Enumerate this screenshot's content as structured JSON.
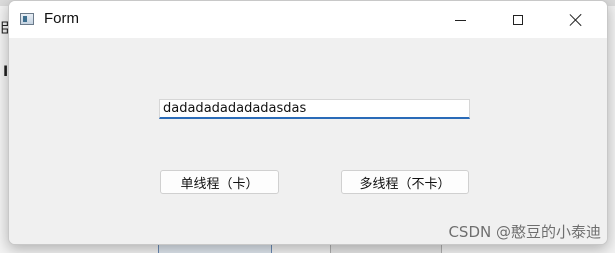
{
  "window": {
    "title": "Form",
    "icon": "app-window-icon",
    "controls": {
      "minimize_icon": "minimize-icon",
      "maximize_icon": "maximize-icon",
      "close_icon": "close-icon"
    }
  },
  "form": {
    "input_value": "dadadadadadadasdas",
    "single_thread_button": "单线程（卡）",
    "multi_thread_button": "多线程（不卡）"
  },
  "background": {
    "left_char_1": "臣",
    "left_char_2": "I"
  },
  "watermark": {
    "text": "CSDN @憨豆的小泰迪"
  },
  "colors": {
    "input_focus_underline": "#2a6bb8",
    "titlebar_bg": "#ffffff",
    "client_bg": "#f0f0f0"
  }
}
